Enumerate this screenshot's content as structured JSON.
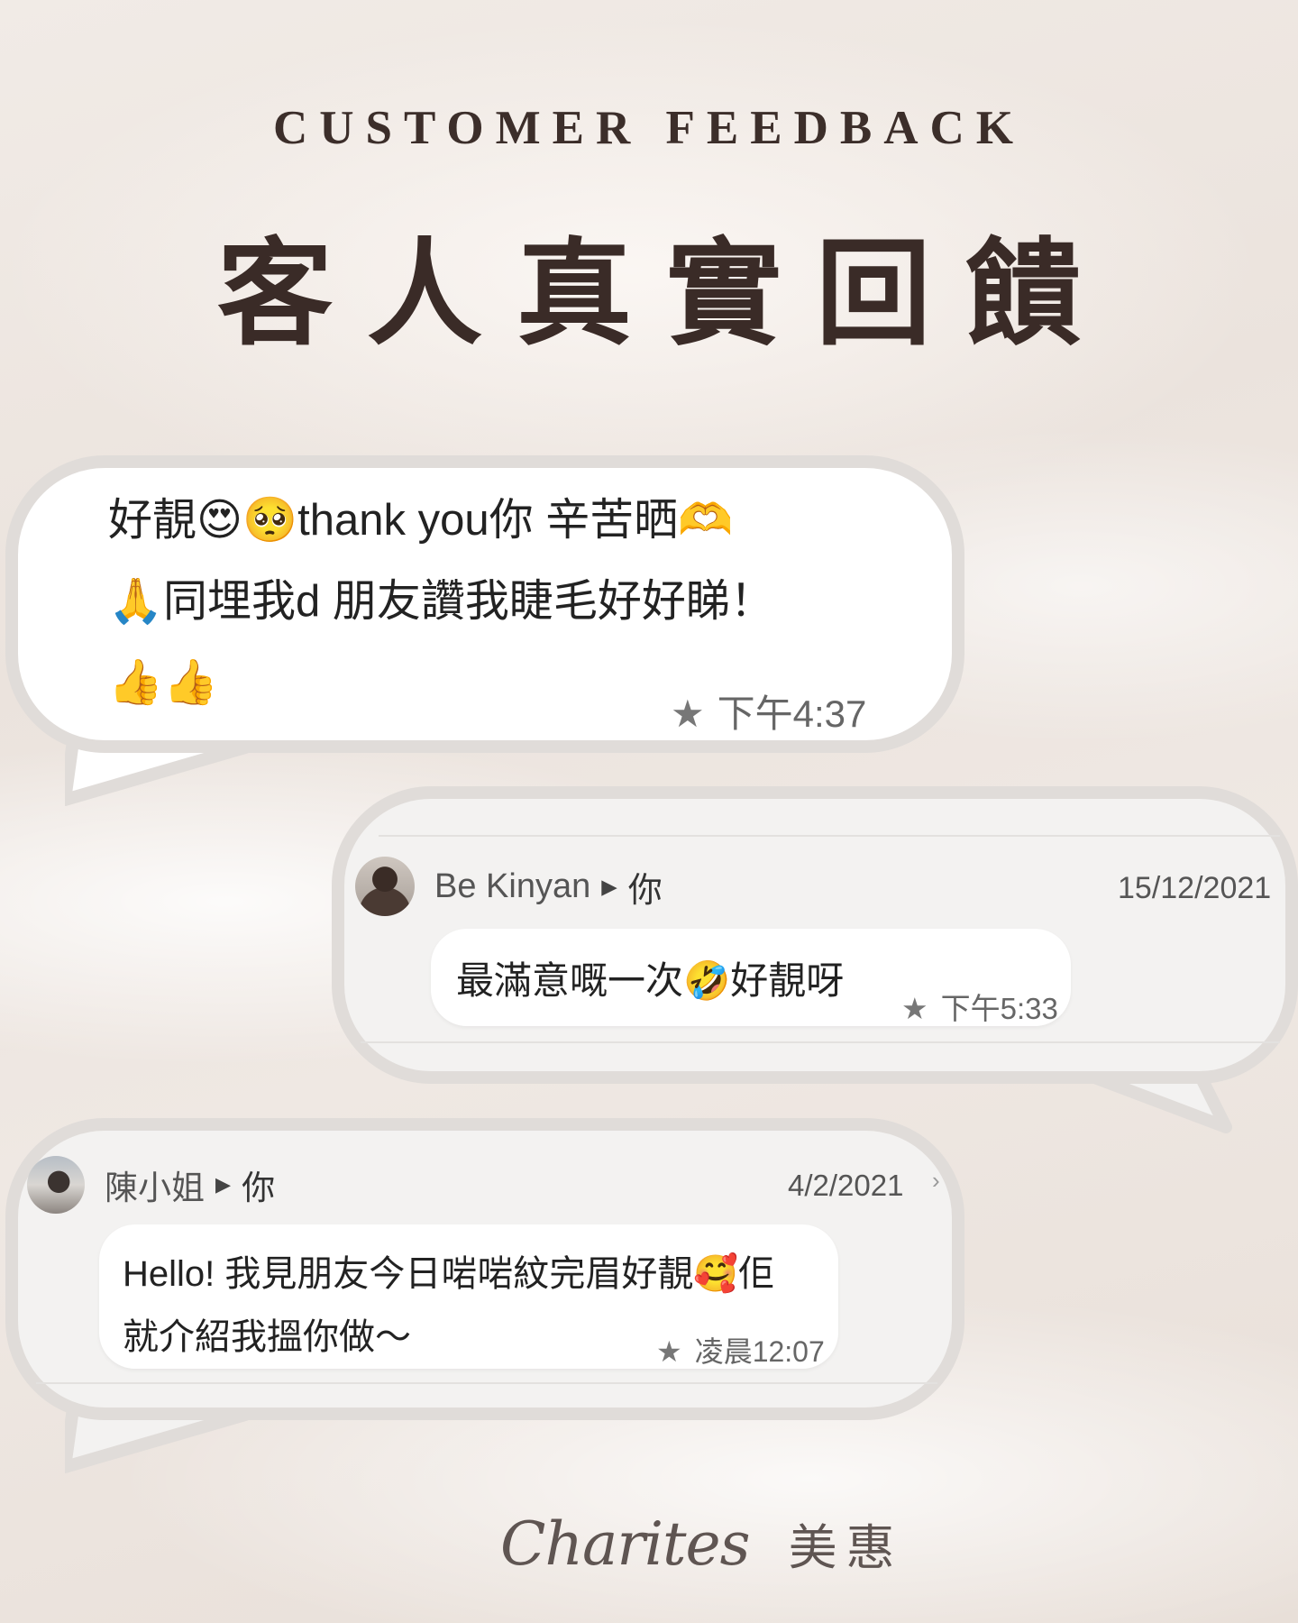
{
  "heading": {
    "english": "CUSTOMER FEEDBACK",
    "chinese": "客人真實回饋"
  },
  "feedback": [
    {
      "lines": [
        "好靚😍🥺thank you你 辛苦晒🫶",
        "🙏同埋我d 朋友讚我睫毛好好睇！",
        "👍👍"
      ],
      "time": "下午4:37"
    },
    {
      "sender": "Be Kinyan",
      "recipient": "你",
      "date": "15/12/2021",
      "text": "最滿意嘅一次🤣好靚呀",
      "time": "下午5:33"
    },
    {
      "sender": "陳小姐",
      "recipient": "你",
      "date": "4/2/2021",
      "lines": [
        "Hello! 我見朋友今日啱啱紋完眉好靚🥰佢",
        "就介紹我搵你做～"
      ],
      "time": "凌晨12:07"
    }
  ],
  "logo": {
    "script": "Charites",
    "chinese": "美惠"
  },
  "icons": {
    "star": "★",
    "arrow": "▶",
    "chevron": "›"
  }
}
